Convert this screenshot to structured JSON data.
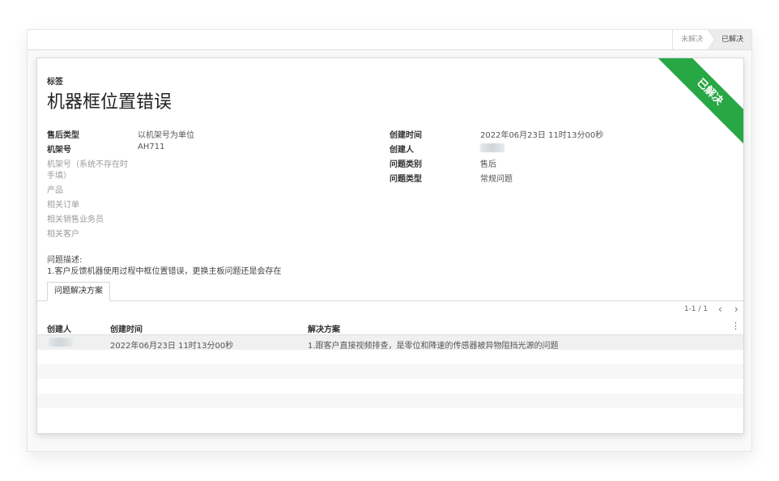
{
  "statusbar": {
    "stage_unsolved": "未解决",
    "stage_solved": "已解决"
  },
  "ribbon": {
    "text": "已解决",
    "color": "#28a745"
  },
  "header": {
    "tag_label": "标签",
    "title": "机器框位置错误"
  },
  "left_fields": {
    "after_sales_type_label": "售后类型",
    "after_sales_type_value": "以机架号为单位",
    "rack_no_label": "机架号",
    "rack_no_value": "AH711",
    "rack_no_unlisted_label_1": "机架号（系统不存在时",
    "rack_no_unlisted_label_2": "手填）",
    "product_label": "产品",
    "related_order_label": "相关订单",
    "related_salesperson_label": "相关销售业务员",
    "related_customer_label": "相关客户"
  },
  "right_fields": {
    "created_time_label": "创建时间",
    "created_time_value": "2022年06月23日 11时13分00秒",
    "creator_label": "创建人",
    "issue_category_label": "问题类别",
    "issue_category_value": "售后",
    "issue_type_label": "问题类型",
    "issue_type_value": "常规问题"
  },
  "description": {
    "label": "问题描述:",
    "text": "1.客户反馈机器使用过程中框位置错误，更换主板问题还是会存在"
  },
  "tabs": [
    {
      "label": "问题解决方案"
    }
  ],
  "pager": {
    "text": "1-1 / 1",
    "prev": "‹",
    "next": "›"
  },
  "table": {
    "columns": [
      "创建人",
      "创建时间",
      "解决方案"
    ],
    "rows": [
      {
        "created_time": "2022年06月23日 11时13分00秒",
        "solution": "1.跟客户直接视频排查，是零位和降速的传感器被异物阻挡光源的问题"
      }
    ]
  }
}
